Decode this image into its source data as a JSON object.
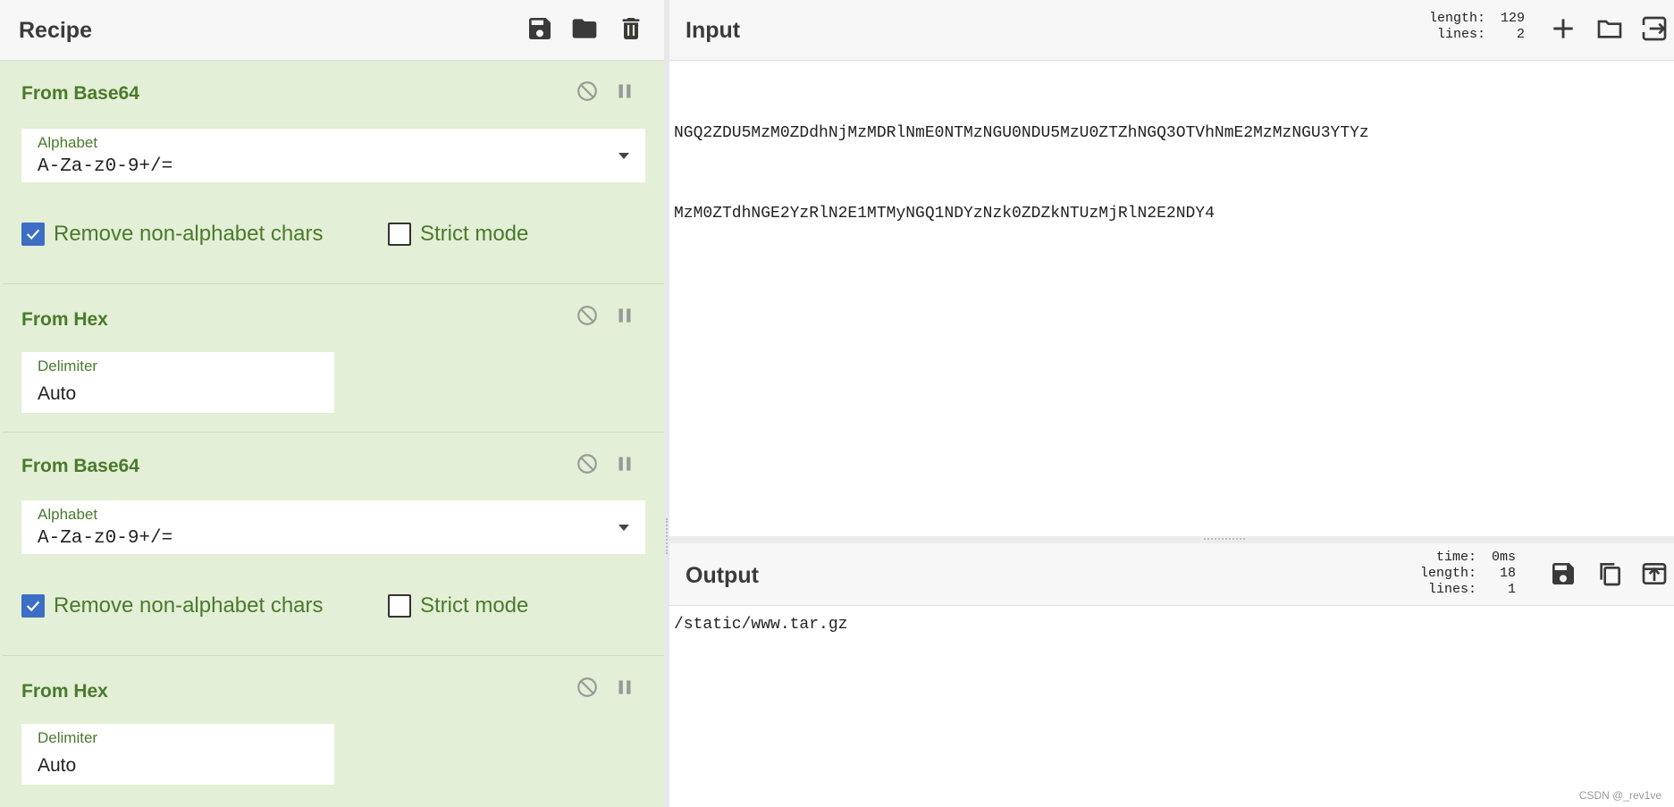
{
  "recipe": {
    "title": "Recipe",
    "header_icons": [
      "save-icon",
      "folder-icon",
      "trash-icon"
    ],
    "operations": [
      {
        "title": "From Base64",
        "field_label": "Alphabet",
        "field_value": "A-Za-z0-9+/=",
        "field_type": "dropdown",
        "checkboxes": [
          {
            "label": "Remove non-alphabet chars",
            "checked": true
          },
          {
            "label": "Strict mode",
            "checked": false
          }
        ]
      },
      {
        "title": "From Hex",
        "field_label": "Delimiter",
        "field_value": "Auto",
        "field_type": "text"
      },
      {
        "title": "From Base64",
        "field_label": "Alphabet",
        "field_value": "A-Za-z0-9+/=",
        "field_type": "dropdown",
        "checkboxes": [
          {
            "label": "Remove non-alphabet chars",
            "checked": true
          },
          {
            "label": "Strict mode",
            "checked": false
          }
        ]
      },
      {
        "title": "From Hex",
        "field_label": "Delimiter",
        "field_value": "Auto",
        "field_type": "text"
      }
    ]
  },
  "input": {
    "title": "Input",
    "stats": {
      "length_label": "length:",
      "length_value": "129",
      "lines_label": "lines:",
      "lines_value": "2"
    },
    "lines": [
      "NGQ2ZDU5MzM0ZDdhNjMzMDRlNmE0NTMzNGU0NDU5MzU0ZTZhNGQ3OTVhNmE2MzMzNGU3YTYz",
      "MzM0ZTdhNGE2YzRlN2E1MTMyNGQ1NDYzNzk0ZDZkNTUzMjRlN2E2NDY4"
    ],
    "header_icons": [
      "plus-icon",
      "open-folder-icon",
      "insert-file-icon"
    ]
  },
  "output": {
    "title": "Output",
    "stats": {
      "time_label": "time:",
      "time_value": "0ms",
      "length_label": "length:",
      "length_value": "18",
      "lines_label": "lines:",
      "lines_value": "1"
    },
    "text": "/static/www.tar.gz",
    "header_icons": [
      "save-icon",
      "copy-icon",
      "replace-input-icon"
    ]
  },
  "watermark": "CSDN @_rev1ve",
  "colors": {
    "recipe_bg": "#e3efd6",
    "op_title": "#4a7a2c",
    "checkbox_checked": "#3b6fc6"
  }
}
